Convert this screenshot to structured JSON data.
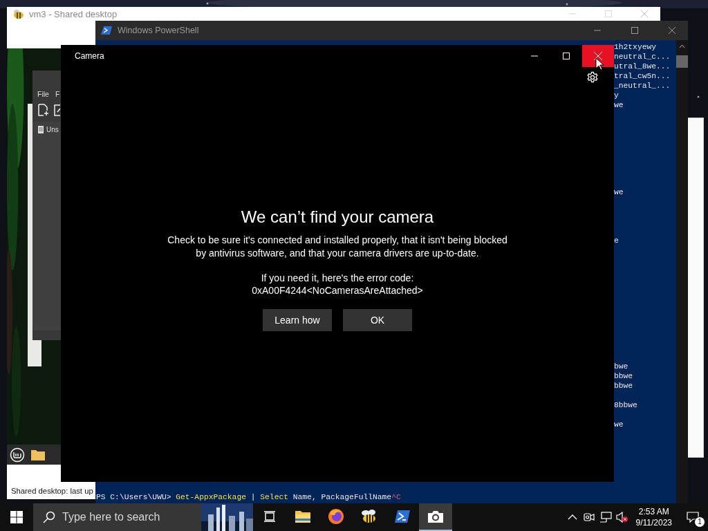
{
  "vm_window": {
    "title": "vm3 - Shared desktop",
    "status": "Shared desktop: last up",
    "guest_window": {
      "menu": [
        "File",
        "F"
      ],
      "file_item": "Uns"
    }
  },
  "powershell": {
    "title": "Windows PowerShell",
    "output_blocks": [
      [
        "1h2txyewy",
        "neutral_c...",
        "utral_8we...",
        "tral_cw5n...",
        "_neutral_...",
        "y",
        "we"
      ],
      [
        "we"
      ],
      [
        "e"
      ],
      [
        "bwe",
        "bbwe",
        "bbwe"
      ],
      [
        "8bbwe"
      ],
      [
        "we"
      ]
    ],
    "prompt": [
      {
        "text": "PS C:\\Users\\UWU> ",
        "kind": "plain"
      },
      {
        "text": "Get-AppxPackage",
        "kind": "command"
      },
      {
        "text": " | ",
        "kind": "plain"
      },
      {
        "text": "Select",
        "kind": "command"
      },
      {
        "text": " Name, PackageFullName",
        "kind": "plain"
      },
      {
        "text": "^C",
        "kind": "interrupt"
      }
    ]
  },
  "camera": {
    "title": "Camera",
    "heading": "We can’t find your camera",
    "message": "Check to be sure it's connected and installed properly, that it isn't being blocked by antivirus software, and that your camera drivers are up-to-date.",
    "error_intro": "If you need it, here's the error code:",
    "error_code": "0xA00F4244<NoCamerasAreAttached>",
    "buttons": [
      "Learn how",
      "OK"
    ]
  },
  "taskbar": {
    "search_placeholder": "Type here to search",
    "apps": [
      {
        "kind": "task-view",
        "selected": false
      },
      {
        "kind": "folder",
        "selected": false
      },
      {
        "kind": "browser",
        "selected": false
      },
      {
        "kind": "bee",
        "selected": false
      },
      {
        "kind": "terminal",
        "selected": false
      },
      {
        "kind": "camera",
        "selected": true
      }
    ],
    "time": "2:53 AM",
    "date": "9/11/2023",
    "notification_count": "1"
  }
}
